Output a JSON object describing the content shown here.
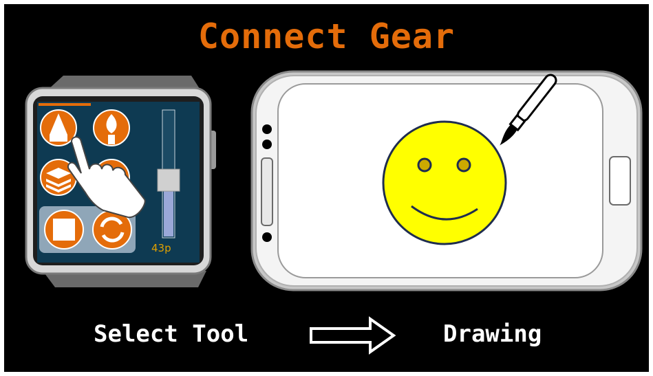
{
  "title": "Connect Gear",
  "watch": {
    "size_label": "43p",
    "slider_level_percent": 45,
    "tools": [
      "pencil-icon",
      "brush-icon",
      "layers-icon",
      "palette-icon",
      "square-icon",
      "rotate-icon"
    ]
  },
  "captions": {
    "left": "Select Tool",
    "right": "Drawing"
  },
  "colors": {
    "accent": "#e46c0a",
    "background": "#000000",
    "screen": "#0e3a52",
    "smiley": "#ffff00"
  }
}
